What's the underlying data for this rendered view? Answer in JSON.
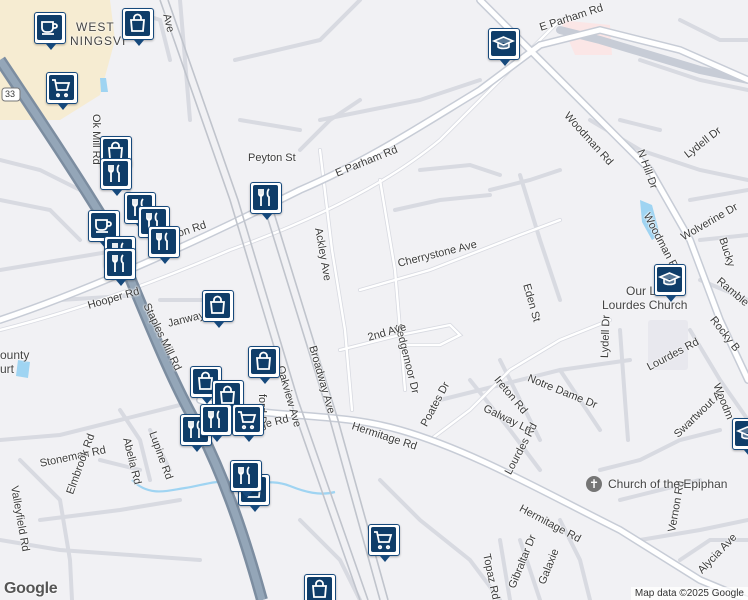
{
  "map": {
    "colors": {
      "background": "#f1f1f4",
      "road": "#ffffff",
      "highway": "#8a9aaa",
      "water": "#9fd4f2",
      "pin_border": "#16497c",
      "pin_fill": "#0f3d69"
    },
    "road_labels": [
      {
        "id": "e-parham-rd-top",
        "text": "E Parham Rd"
      },
      {
        "id": "e-parham-rd-mid",
        "text": "E Parham Rd"
      },
      {
        "id": "woodman-rd-top",
        "text": "Woodman Rd"
      },
      {
        "id": "woodman-rd-mid",
        "text": "Woodman Rd"
      },
      {
        "id": "woodman-rd-edge",
        "text": "Woodm"
      },
      {
        "id": "peyton-st",
        "text": "Peyton St"
      },
      {
        "id": "ackley-ave",
        "text": "Ackley Ave"
      },
      {
        "id": "cherrystone-ave",
        "text": "Cherrystone Ave"
      },
      {
        "id": "sedgemoor-dr",
        "text": "Sedgemoor Dr"
      },
      {
        "id": "eden-st",
        "text": "Eden St"
      },
      {
        "id": "n-hill-dr",
        "text": "N Hill Dr"
      },
      {
        "id": "lydell-dr-top",
        "text": "Lydell Dr"
      },
      {
        "id": "lydell-dr-right",
        "text": "Lydell Dr"
      },
      {
        "id": "wolverine-dr",
        "text": "Wolverine Dr"
      },
      {
        "id": "bucky",
        "text": "Bucky"
      },
      {
        "id": "ramble",
        "text": "Ramble"
      },
      {
        "id": "rocky-b",
        "text": "Rocky B"
      },
      {
        "id": "lourdes-rd-right",
        "text": "Lourdes Rd"
      },
      {
        "id": "lourdes-rd-bottom",
        "text": "Lourdes Rd"
      },
      {
        "id": "notre-dame-dr",
        "text": "Notre Dame Dr"
      },
      {
        "id": "ireton-rd",
        "text": "Ireton Rd"
      },
      {
        "id": "galway-ln",
        "text": "Galway Ln"
      },
      {
        "id": "poates-dr",
        "text": "Poates Dr"
      },
      {
        "id": "second-ave",
        "text": "2nd Ave"
      },
      {
        "id": "broadway-ave",
        "text": "Broadway Ave"
      },
      {
        "id": "oakview-ave",
        "text": "Oakview Ave"
      },
      {
        "id": "hermitage-rd-left",
        "text": "Hermitage Rd"
      },
      {
        "id": "hermitage-rd-bottom",
        "text": "Hermitage Rd"
      },
      {
        "id": "ge-rd",
        "text": "ge Rd"
      },
      {
        "id": "ford-dr",
        "text": "ford Dr"
      },
      {
        "id": "hooper-rd",
        "text": "Hooper Rd"
      },
      {
        "id": "janway",
        "text": "Janway"
      },
      {
        "id": "staples-mill-rd",
        "text": "Staples Mill Rd"
      },
      {
        "id": "ok-mill-rd",
        "text": "Ok Mill Rd"
      },
      {
        "id": "on-rd",
        "text": "on Rd"
      },
      {
        "id": "abelia-rd",
        "text": "Abelia Rd"
      },
      {
        "id": "lupine-rd",
        "text": "Lupine Rd"
      },
      {
        "id": "stoneman-rd",
        "text": "Stoneman Rd"
      },
      {
        "id": "valleyfield-rd",
        "text": "Valleyfield Rd"
      },
      {
        "id": "elmbrook-rd",
        "text": "Elmbrook Rd"
      },
      {
        "id": "swartwout-a",
        "text": "Swartwout A"
      },
      {
        "id": "vernon-rd",
        "text": "Vernon Rd"
      },
      {
        "id": "alycia-ave",
        "text": "Alycia Ave"
      },
      {
        "id": "topaz-rd",
        "text": "Topaz Rd"
      },
      {
        "id": "gibraltar-dr",
        "text": "Gibraltar Dr"
      },
      {
        "id": "galaxie",
        "text": "Galaxie"
      },
      {
        "id": "oakview-ave-top",
        "text": "Ave"
      },
      {
        "id": "route-33",
        "text": "33"
      }
    ],
    "place_labels": [
      {
        "id": "west-henrico",
        "text": "WEST"
      },
      {
        "id": "west-henrico-2",
        "text": "NINGSVI"
      },
      {
        "id": "our-lady-1",
        "text": "Our Lady"
      },
      {
        "id": "our-lady-2",
        "text": "Lourdes Church"
      },
      {
        "id": "church-epiphany",
        "text": "Church of the Epiphan"
      },
      {
        "id": "county-1",
        "text": "ounty"
      },
      {
        "id": "county-2",
        "text": "urt"
      }
    ],
    "pins": [
      {
        "id": "pin-coffee-top",
        "icon": "coffee-icon"
      },
      {
        "id": "pin-coffee-mid",
        "icon": "coffee-icon"
      },
      {
        "id": "pin-shopping-top",
        "icon": "shopping-bag-icon"
      },
      {
        "id": "pin-cart-top",
        "icon": "shopping-cart-icon"
      },
      {
        "id": "pin-school-top",
        "icon": "school-icon"
      },
      {
        "id": "pin-school-right",
        "icon": "school-icon"
      },
      {
        "id": "pin-shopping-mid1",
        "icon": "shopping-bag-icon"
      },
      {
        "id": "pin-restaurant-1",
        "icon": "restaurant-icon"
      },
      {
        "id": "pin-restaurant-2",
        "icon": "restaurant-icon"
      },
      {
        "id": "pin-restaurant-3",
        "icon": "restaurant-icon"
      },
      {
        "id": "pin-restaurant-4",
        "icon": "restaurant-icon"
      },
      {
        "id": "pin-restaurant-5",
        "icon": "restaurant-icon"
      },
      {
        "id": "pin-restaurant-6",
        "icon": "restaurant-icon"
      },
      {
        "id": "pin-restaurant-7",
        "icon": "restaurant-icon"
      },
      {
        "id": "pin-shopping-janway",
        "icon": "shopping-bag-icon"
      },
      {
        "id": "pin-shopping-oakview",
        "icon": "shopping-bag-icon"
      },
      {
        "id": "pin-shopping-hermitage1",
        "icon": "shopping-bag-icon"
      },
      {
        "id": "pin-shopping-hermitage2",
        "icon": "shopping-bag-icon"
      },
      {
        "id": "pin-cart-hermitage",
        "icon": "shopping-cart-icon"
      },
      {
        "id": "pin-restaurant-hermitage1",
        "icon": "restaurant-icon"
      },
      {
        "id": "pin-restaurant-hermitage2",
        "icon": "restaurant-icon"
      },
      {
        "id": "pin-shopping-lower",
        "icon": "shopping-bag-icon"
      },
      {
        "id": "pin-restaurant-lower",
        "icon": "restaurant-icon"
      },
      {
        "id": "pin-cart-bottom",
        "icon": "shopping-cart-icon"
      },
      {
        "id": "pin-shopping-bottom",
        "icon": "shopping-bag-icon"
      },
      {
        "id": "pin-school-edge",
        "icon": "school-icon"
      }
    ],
    "attribution": "Map data ©2025 Google",
    "logo": "Google"
  }
}
